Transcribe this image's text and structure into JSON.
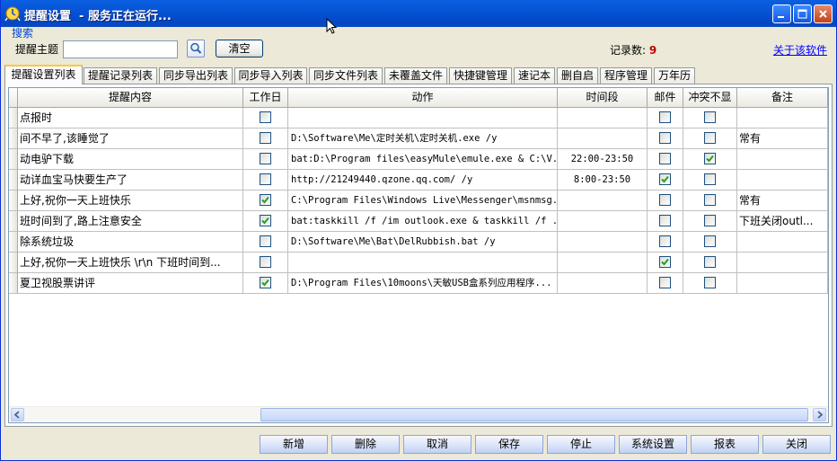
{
  "window": {
    "title": "提醒设置  - 服务正在运行...",
    "colors": {
      "titlebar": "#0654d6",
      "accent": "#0046d5",
      "count": "#c00000"
    }
  },
  "search": {
    "group_label": "搜索",
    "subject_label": "提醒主题",
    "subject_value": "",
    "clear_label": "清空",
    "count_label": "记录数:",
    "count_value": "9",
    "about_label": "关于该软件"
  },
  "tabs": [
    {
      "label": "提醒设置列表",
      "active": true
    },
    {
      "label": "提醒记录列表"
    },
    {
      "label": "同步导出列表"
    },
    {
      "label": "同步导入列表"
    },
    {
      "label": "同步文件列表"
    },
    {
      "label": "未覆盖文件"
    },
    {
      "label": "快捷键管理"
    },
    {
      "label": "速记本"
    },
    {
      "label": "删自启"
    },
    {
      "label": "程序管理"
    },
    {
      "label": "万年历"
    }
  ],
  "table": {
    "columns": [
      "提醒内容",
      "工作日",
      "动作",
      "时间段",
      "邮件",
      "冲突不显",
      "备注"
    ],
    "rows": [
      {
        "content": "点报时",
        "workday": false,
        "action": "",
        "time": "",
        "mail": false,
        "noconflict": false,
        "note": ""
      },
      {
        "content": "间不早了,该睡觉了",
        "workday": false,
        "action": "D:\\Software\\Me\\定时关机\\定时关机.exe /y",
        "time": "",
        "mail": false,
        "noconflict": false,
        "note": "常有"
      },
      {
        "content": "动电驴下载",
        "workday": false,
        "action": "bat:D:\\Program files\\easyMule\\emule.exe & C:\\V...",
        "time": "22:00-23:50",
        "mail": false,
        "noconflict": true,
        "note": ""
      },
      {
        "content": "动详血宝马快要生产了",
        "workday": false,
        "action": "http://21249440.qzone.qq.com/ /y",
        "time": "8:00-23:50",
        "mail": true,
        "noconflict": false,
        "note": ""
      },
      {
        "content": "上好,祝你一天上班快乐",
        "workday": true,
        "action": "C:\\Program Files\\Windows Live\\Messenger\\msnmsg...",
        "time": "",
        "mail": false,
        "noconflict": false,
        "note": "常有"
      },
      {
        "content": "班时间到了,路上注意安全",
        "workday": true,
        "action": "bat:taskkill /f /im outlook.exe & taskkill /f ...",
        "time": "",
        "mail": false,
        "noconflict": false,
        "note": "下班关闭outl..."
      },
      {
        "content": "除系统垃圾",
        "workday": false,
        "action": "D:\\Software\\Me\\Bat\\DelRubbish.bat /y",
        "time": "",
        "mail": false,
        "noconflict": false,
        "note": ""
      },
      {
        "content": "上好,祝你一天上班快乐 \\r\\n 下班时间到...",
        "workday": false,
        "action": "",
        "time": "",
        "mail": true,
        "noconflict": false,
        "note": ""
      },
      {
        "content": "夏卫视股票讲评",
        "workday": true,
        "action": "D:\\Program Files\\10moons\\天敏USB盒系列应用程序...",
        "time": "",
        "mail": false,
        "noconflict": false,
        "note": ""
      }
    ]
  },
  "buttons": [
    "新增",
    "删除",
    "取消",
    "保存",
    "停止",
    "系统设置",
    "报表",
    "关闭"
  ],
  "icons": {
    "app": "bell-clock-icon",
    "search": "search-icon",
    "minimize": "minimize-icon",
    "maximize": "maximize-icon",
    "close": "close-icon",
    "cursor": "mouse-cursor-icon"
  }
}
